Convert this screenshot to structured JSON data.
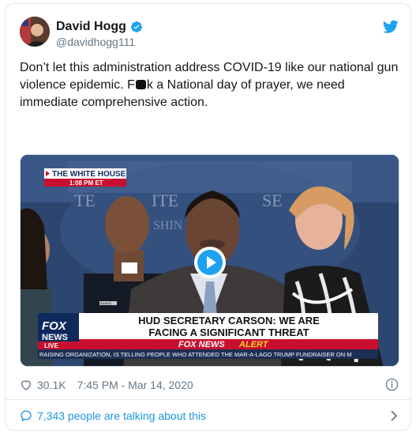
{
  "tweet": {
    "author_name": "David Hogg",
    "author_handle": "@davidhogg111",
    "text_part1": "Don’t let this administration address COVID-19 like our national gun violence epidemic. F",
    "text_part2": "k a National day of prayer, we need immediate comprehensive action.",
    "likes": "30.1K",
    "timestamp": "7:45 PM - Mar 14, 2020",
    "talking": "7,343 people are talking about this"
  },
  "video": {
    "location_tag": "THE WHITE HOUSE",
    "time_tag": "1:08 PM ET",
    "bg_text_1": "TE",
    "bg_text_2": "ITE",
    "bg_text_3": "SE",
    "bg_text_4": "SHIN",
    "lower_third_line1": "HUD SECRETARY CARSON: WE ARE",
    "lower_third_line2": "FACING A SIGNIFICANT THREAT",
    "fox_logo_1": "FOX",
    "fox_logo_2": "NEWS",
    "fox_logo_3": "LIVE",
    "alert_brand": "FOX NEWS",
    "alert_word": "ALERT",
    "ticker": "RAISING ORGANIZATION, IS TELLING PEOPLE WHO ATTENDED THE MAR-A-LAGO TRUMP FUNDRAISER ON M",
    "name_plate": "ADAMS"
  },
  "colors": {
    "link_blue": "#1b95e0",
    "twitter_blue": "#1da1f2",
    "text_dark": "#14171a",
    "text_gray": "#657786",
    "fox_red": "#c8102e",
    "fox_navy": "#0e2a5c"
  },
  "icons": [
    "verified-badge-icon",
    "twitter-bird-icon",
    "heart-icon",
    "info-icon",
    "comment-bubble-icon",
    "chevron-right-icon",
    "play-icon"
  ]
}
